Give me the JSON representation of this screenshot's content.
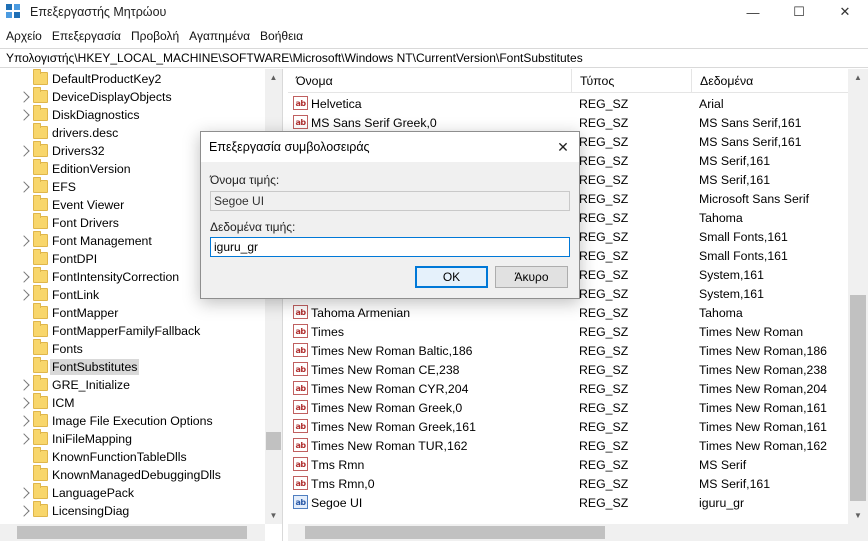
{
  "window": {
    "title": "Επεξεργαστής Μητρώου",
    "minimize_glyph": "—",
    "maximize_glyph": "☐",
    "close_glyph": "✕"
  },
  "menu": [
    "Αρχείο",
    "Επεξεργασία",
    "Προβολή",
    "Αγαπημένα",
    "Βοήθεια"
  ],
  "address": "Υπολογιστής\\HKEY_LOCAL_MACHINE\\SOFTWARE\\Microsoft\\Windows NT\\CurrentVersion\\FontSubstitutes",
  "tree": {
    "items": [
      {
        "label": "DefaultProductKey2",
        "expandable": false
      },
      {
        "label": "DeviceDisplayObjects",
        "expandable": true
      },
      {
        "label": "DiskDiagnostics",
        "expandable": true
      },
      {
        "label": "drivers.desc",
        "expandable": false
      },
      {
        "label": "Drivers32",
        "expandable": true
      },
      {
        "label": "EditionVersion",
        "expandable": false
      },
      {
        "label": "EFS",
        "expandable": true
      },
      {
        "label": "Event Viewer",
        "expandable": false
      },
      {
        "label": "Font Drivers",
        "expandable": false
      },
      {
        "label": "Font Management",
        "expandable": true
      },
      {
        "label": "FontDPI",
        "expandable": false
      },
      {
        "label": "FontIntensityCorrection",
        "expandable": true
      },
      {
        "label": "FontLink",
        "expandable": true
      },
      {
        "label": "FontMapper",
        "expandable": false
      },
      {
        "label": "FontMapperFamilyFallback",
        "expandable": false
      },
      {
        "label": "Fonts",
        "expandable": false
      },
      {
        "label": "FontSubstitutes",
        "expandable": false,
        "selected": true
      },
      {
        "label": "GRE_Initialize",
        "expandable": true
      },
      {
        "label": "ICM",
        "expandable": true
      },
      {
        "label": "Image File Execution Options",
        "expandable": true
      },
      {
        "label": "IniFileMapping",
        "expandable": true
      },
      {
        "label": "KnownFunctionTableDlls",
        "expandable": false
      },
      {
        "label": "KnownManagedDebuggingDlls",
        "expandable": false
      },
      {
        "label": "LanguagePack",
        "expandable": true
      },
      {
        "label": "LicensingDiag",
        "expandable": true
      }
    ]
  },
  "list": {
    "headers": {
      "name": "Όνομα",
      "type": "Τύπος",
      "data": "Δεδομένα"
    },
    "rows": [
      {
        "name": "Helvetica",
        "type": "REG_SZ",
        "data": "Arial",
        "icon": "string-value-icon"
      },
      {
        "name": "MS Sans Serif Greek,0",
        "type": "REG_SZ",
        "data": "MS Sans Serif,161",
        "icon": "string-value-icon"
      },
      {
        "name": "",
        "type": "REG_SZ",
        "data": "MS Sans Serif,161",
        "icon": ""
      },
      {
        "name": "",
        "type": "REG_SZ",
        "data": "MS Serif,161",
        "icon": ""
      },
      {
        "name": "",
        "type": "REG_SZ",
        "data": "MS Serif,161",
        "icon": ""
      },
      {
        "name": "",
        "type": "REG_SZ",
        "data": "Microsoft Sans Serif",
        "icon": ""
      },
      {
        "name": "",
        "type": "REG_SZ",
        "data": "Tahoma",
        "icon": ""
      },
      {
        "name": "",
        "type": "REG_SZ",
        "data": "Small Fonts,161",
        "icon": ""
      },
      {
        "name": "",
        "type": "REG_SZ",
        "data": "Small Fonts,161",
        "icon": ""
      },
      {
        "name": "",
        "type": "REG_SZ",
        "data": "System,161",
        "icon": ""
      },
      {
        "name": "",
        "type": "REG_SZ",
        "data": "System,161",
        "icon": ""
      },
      {
        "name": "Tahoma Armenian",
        "type": "REG_SZ",
        "data": "Tahoma",
        "icon": "string-value-icon"
      },
      {
        "name": "Times",
        "type": "REG_SZ",
        "data": "Times New Roman",
        "icon": "string-value-icon"
      },
      {
        "name": "Times New Roman Baltic,186",
        "type": "REG_SZ",
        "data": "Times New Roman,186",
        "icon": "string-value-icon"
      },
      {
        "name": "Times New Roman CE,238",
        "type": "REG_SZ",
        "data": "Times New Roman,238",
        "icon": "string-value-icon"
      },
      {
        "name": "Times New Roman CYR,204",
        "type": "REG_SZ",
        "data": "Times New Roman,204",
        "icon": "string-value-icon"
      },
      {
        "name": "Times New Roman Greek,0",
        "type": "REG_SZ",
        "data": "Times New Roman,161",
        "icon": "string-value-icon"
      },
      {
        "name": "Times New Roman Greek,161",
        "type": "REG_SZ",
        "data": "Times New Roman,161",
        "icon": "string-value-icon"
      },
      {
        "name": "Times New Roman TUR,162",
        "type": "REG_SZ",
        "data": "Times New Roman,162",
        "icon": "string-value-icon"
      },
      {
        "name": "Tms Rmn",
        "type": "REG_SZ",
        "data": "MS Serif",
        "icon": "string-value-icon"
      },
      {
        "name": "Tms Rmn,0",
        "type": "REG_SZ",
        "data": "MS Serif,161",
        "icon": "string-value-icon"
      },
      {
        "name": "Segoe UI",
        "type": "REG_SZ",
        "data": "iguru_gr",
        "icon": "string-value-icon-selected"
      }
    ],
    "icon_text": "ab"
  },
  "dialog": {
    "title": "Επεξεργασία συμβολοσειράς",
    "value_name_label": "Όνομα τιμής:",
    "value_name": "Segoe UI",
    "value_data_label": "Δεδομένα τιμής:",
    "value_data": "iguru_gr",
    "ok_label": "OK",
    "cancel_label": "Άκυρο",
    "close_glyph": "✕"
  }
}
